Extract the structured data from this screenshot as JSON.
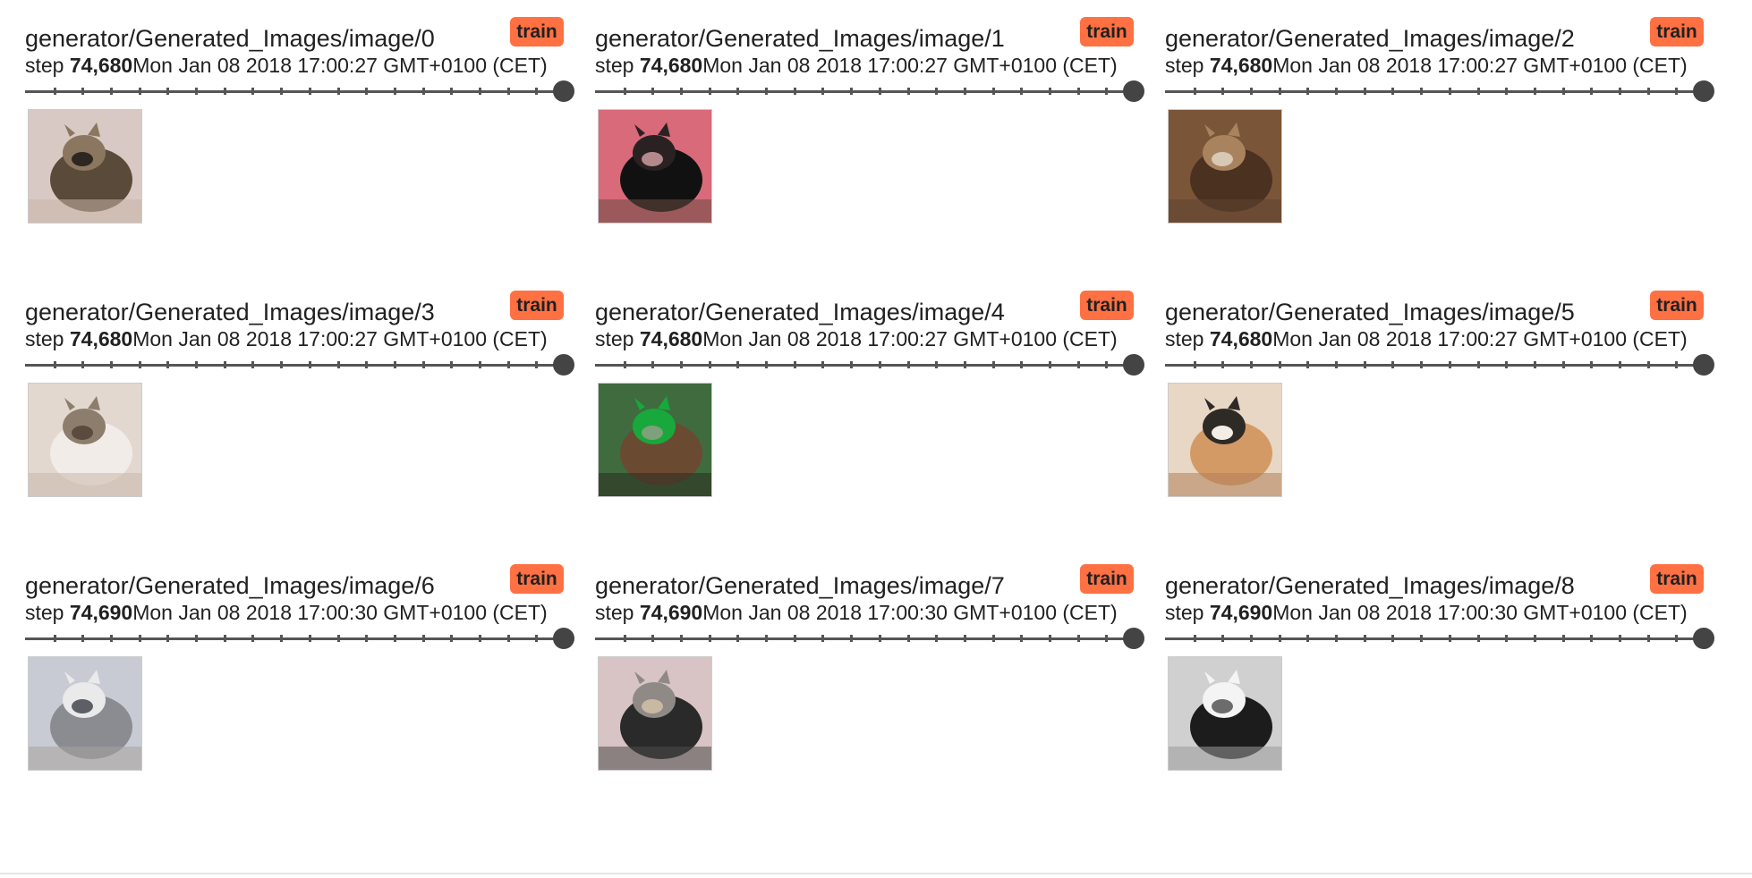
{
  "cards": [
    {
      "tag": "generator/Generated_Images/image/0",
      "run": "train",
      "step_label": "step",
      "step": "74,680",
      "wall_time": "Mon Jan 08 2018 17:00:27 GMT+0100 (CET)",
      "image": "cat-tabby-on-pillow",
      "slider_value": 1.0
    },
    {
      "tag": "generator/Generated_Images/image/1",
      "run": "train",
      "step_label": "step",
      "step": "74,680",
      "wall_time": "Mon Jan 08 2018 17:00:27 GMT+0100 (CET)",
      "image": "cat-black-on-pink",
      "slider_value": 1.0
    },
    {
      "tag": "generator/Generated_Images/image/2",
      "run": "train",
      "step_label": "step",
      "step": "74,680",
      "wall_time": "Mon Jan 08 2018 17:00:27 GMT+0100 (CET)",
      "image": "cat-brown-noisy",
      "slider_value": 1.0
    },
    {
      "tag": "generator/Generated_Images/image/3",
      "run": "train",
      "step_label": "step",
      "step": "74,680",
      "wall_time": "Mon Jan 08 2018 17:00:27 GMT+0100 (CET)",
      "image": "cat-white-face",
      "slider_value": 1.0
    },
    {
      "tag": "generator/Generated_Images/image/4",
      "run": "train",
      "step_label": "step",
      "step": "74,680",
      "wall_time": "Mon Jan 08 2018 17:00:27 GMT+0100 (CET)",
      "image": "cat-on-green-grass",
      "slider_value": 1.0
    },
    {
      "tag": "generator/Generated_Images/image/5",
      "run": "train",
      "step_label": "step",
      "step": "74,680",
      "wall_time": "Mon Jan 08 2018 17:00:27 GMT+0100 (CET)",
      "image": "cat-ginger-sleeping",
      "slider_value": 1.0
    },
    {
      "tag": "generator/Generated_Images/image/6",
      "run": "train",
      "step_label": "step",
      "step": "74,690",
      "wall_time": "Mon Jan 08 2018 17:00:30 GMT+0100 (CET)",
      "image": "cats-grey-pair",
      "slider_value": 1.0
    },
    {
      "tag": "generator/Generated_Images/image/7",
      "run": "train",
      "step_label": "step",
      "step": "74,690",
      "wall_time": "Mon Jan 08 2018 17:00:30 GMT+0100 (CET)",
      "image": "cat-outdoor-dark",
      "slider_value": 1.0
    },
    {
      "tag": "generator/Generated_Images/image/8",
      "run": "train",
      "step_label": "step",
      "step": "74,690",
      "wall_time": "Mon Jan 08 2018 17:00:30 GMT+0100 (CET)",
      "image": "cat-black-white",
      "slider_value": 1.0
    }
  ],
  "colors": {
    "run_badge": "#ff7043",
    "slider": "#444444"
  }
}
